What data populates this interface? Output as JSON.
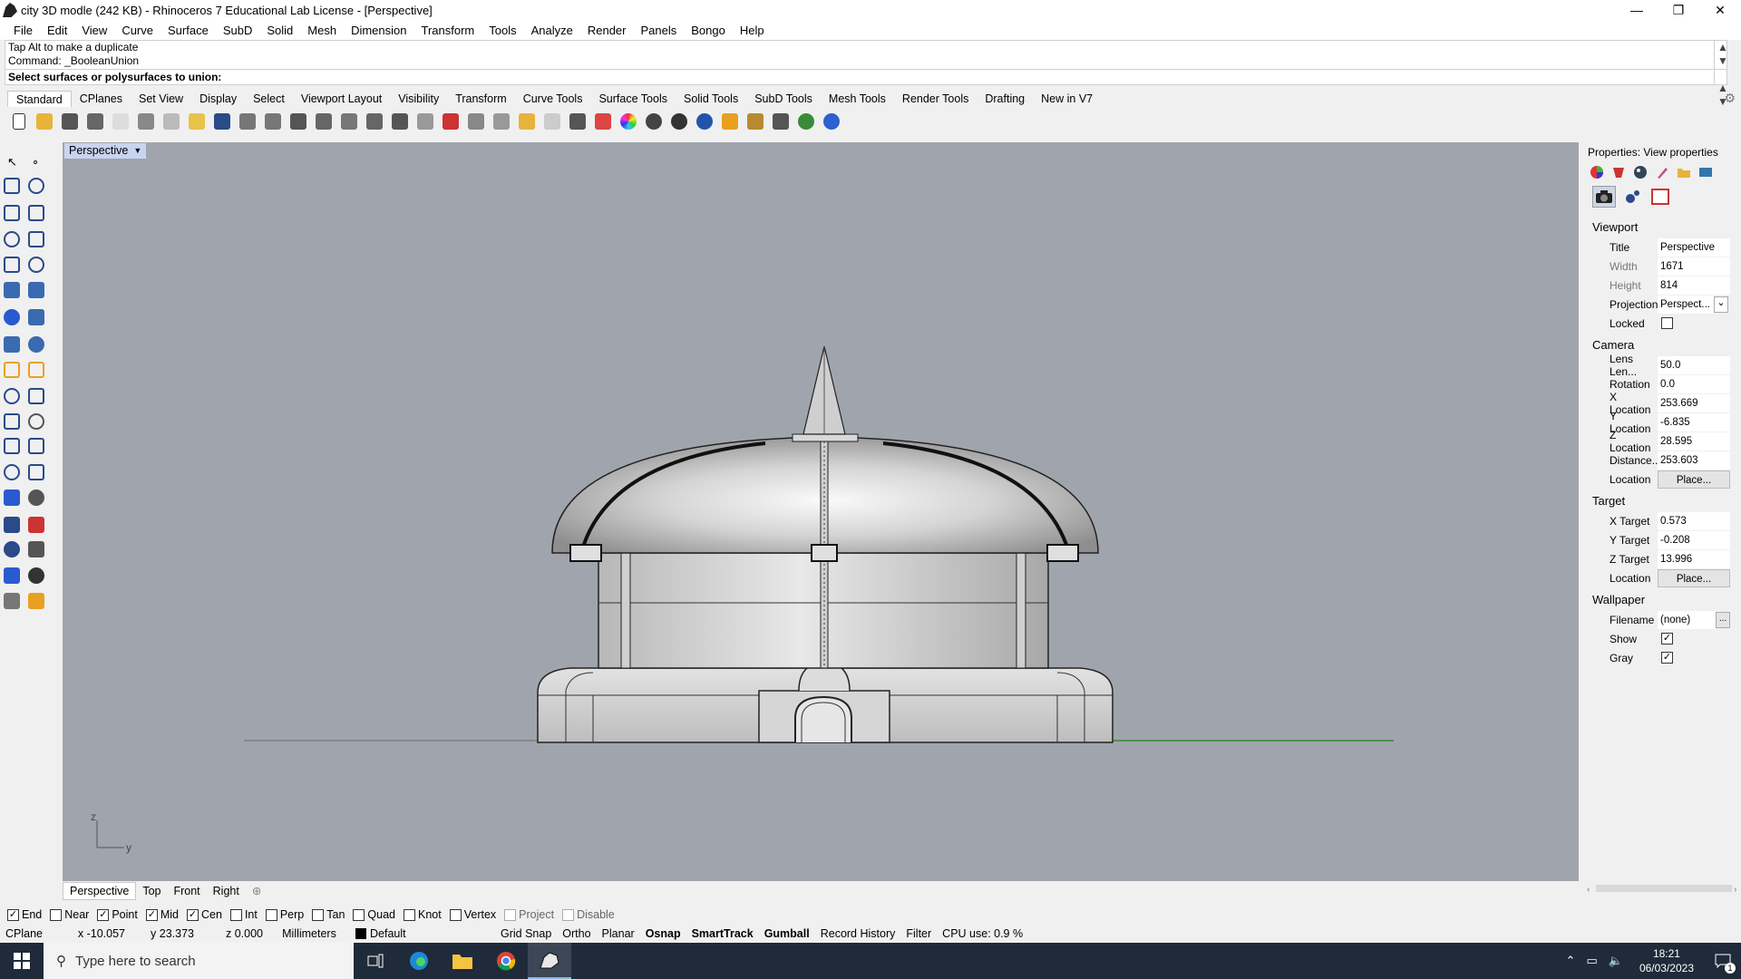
{
  "window": {
    "title": "city 3D modle (242 KB) - Rhinoceros 7 Educational Lab License - [Perspective]",
    "min": "—",
    "max": "❐",
    "close": "✕"
  },
  "menu": [
    "File",
    "Edit",
    "View",
    "Curve",
    "Surface",
    "SubD",
    "Solid",
    "Mesh",
    "Dimension",
    "Transform",
    "Tools",
    "Analyze",
    "Render",
    "Panels",
    "Bongo",
    "Help"
  ],
  "command": {
    "history": [
      "Tap Alt to make a duplicate",
      "Command: _BooleanUnion"
    ],
    "prompt": "Select surfaces or polysurfaces to union:"
  },
  "toolbar_tabs": [
    "Standard",
    "CPlanes",
    "Set View",
    "Display",
    "Select",
    "Viewport Layout",
    "Visibility",
    "Transform",
    "Curve Tools",
    "Surface Tools",
    "Solid Tools",
    "SubD Tools",
    "Mesh Tools",
    "Render Tools",
    "Drafting",
    "New in V7"
  ],
  "toolbar_icons": [
    "new-icon",
    "open-icon",
    "save-icon",
    "print-icon",
    "import-icon",
    "cut-icon",
    "copy-icon",
    "paste-icon",
    "undo-icon",
    "pan-icon",
    "rotate-view-icon",
    "zoom-icon",
    "zoom-window-icon",
    "zoom-extents-icon",
    "zoom-selected-icon",
    "rotate-icon",
    "four-views-icon",
    "car-icon",
    "camera-icon",
    "cplane-icon",
    "point-icon",
    "light-icon",
    "lock-icon",
    "layer-icon",
    "color-wheel-icon",
    "shade-icon",
    "render-icon",
    "sphere-icon",
    "texture-icon",
    "settings-icon",
    "grid-icon",
    "globe-icon",
    "help-icon"
  ],
  "viewport": {
    "name": "Perspective",
    "axis_z": "z",
    "axis_y": "y"
  },
  "viewport_tabs": [
    "Perspective",
    "Top",
    "Front",
    "Right"
  ],
  "properties": {
    "header": "Properties: View properties",
    "sections": {
      "viewport": "Viewport",
      "camera": "Camera",
      "target": "Target",
      "wallpaper": "Wallpaper"
    },
    "viewport_rows": [
      {
        "label": "Title",
        "value": "Perspective"
      },
      {
        "label": "Width",
        "value": "1671"
      },
      {
        "label": "Height",
        "value": "814"
      },
      {
        "label": "Projection",
        "value": "Perspect..."
      },
      {
        "label": "Locked",
        "value": ""
      }
    ],
    "camera_rows": [
      {
        "label": "Lens Len...",
        "value": "50.0"
      },
      {
        "label": "Rotation",
        "value": "0.0"
      },
      {
        "label": "X Location",
        "value": "253.669"
      },
      {
        "label": "Y Location",
        "value": "-6.835"
      },
      {
        "label": "Z Location",
        "value": "28.595"
      },
      {
        "label": "Distance...",
        "value": "253.603"
      },
      {
        "label": "Location",
        "value": "Place..."
      }
    ],
    "target_rows": [
      {
        "label": "X Target",
        "value": "0.573"
      },
      {
        "label": "Y Target",
        "value": "-0.208"
      },
      {
        "label": "Z Target",
        "value": "13.996"
      },
      {
        "label": "Location",
        "value": "Place..."
      }
    ],
    "wallpaper_rows": [
      {
        "label": "Filename",
        "value": "(none)",
        "extra": "..."
      },
      {
        "label": "Show",
        "checked": true
      },
      {
        "label": "Gray",
        "checked": true
      }
    ]
  },
  "osnaps": [
    {
      "label": "End",
      "checked": true
    },
    {
      "label": "Near",
      "checked": false
    },
    {
      "label": "Point",
      "checked": true
    },
    {
      "label": "Mid",
      "checked": true
    },
    {
      "label": "Cen",
      "checked": true
    },
    {
      "label": "Int",
      "checked": false
    },
    {
      "label": "Perp",
      "checked": false
    },
    {
      "label": "Tan",
      "checked": false
    },
    {
      "label": "Quad",
      "checked": false
    },
    {
      "label": "Knot",
      "checked": false
    },
    {
      "label": "Vertex",
      "checked": false
    },
    {
      "label": "Project",
      "checked": false,
      "disabled": true
    },
    {
      "label": "Disable",
      "checked": false,
      "disabled": true
    }
  ],
  "status": {
    "cplane": "CPlane",
    "x": "x -10.057",
    "y": "y 23.373",
    "z": "z 0.000",
    "units": "Millimeters",
    "layer": "Default",
    "toggles": [
      {
        "label": "Grid Snap",
        "bold": false
      },
      {
        "label": "Ortho",
        "bold": false
      },
      {
        "label": "Planar",
        "bold": false
      },
      {
        "label": "Osnap",
        "bold": true
      },
      {
        "label": "SmartTrack",
        "bold": true
      },
      {
        "label": "Gumball",
        "bold": true
      },
      {
        "label": "Record History",
        "bold": false
      },
      {
        "label": "Filter",
        "bold": false
      }
    ],
    "cpu": "CPU use: 0.9 %"
  },
  "taskbar": {
    "search_placeholder": "Type here to search",
    "time": "18:21",
    "date": "06/03/2023",
    "notification_count": "1"
  }
}
